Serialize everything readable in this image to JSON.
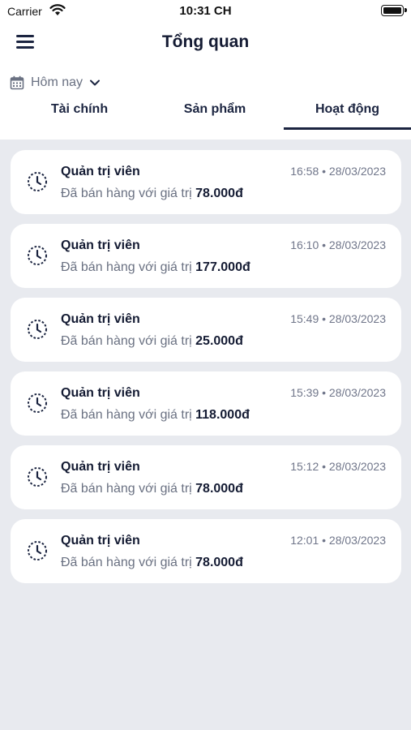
{
  "status_bar": {
    "carrier": "Carrier",
    "time": "10:31 CH"
  },
  "header": {
    "title": "Tổng quan",
    "menu_icon": "hamburger-menu-icon"
  },
  "filter": {
    "date_label": "Hôm nay",
    "calendar_icon": "calendar-icon",
    "dropdown_icon": "chevron-down-icon"
  },
  "tabs": [
    {
      "label": "Tài chính",
      "active": false
    },
    {
      "label": "Sản phẩm",
      "active": false
    },
    {
      "label": "Hoạt động",
      "active": true
    }
  ],
  "activities": [
    {
      "title": "Quản trị viên",
      "time": "16:58 • 28/03/2023",
      "desc": "Đã bán hàng với giá trị ",
      "amount": "78.000đ"
    },
    {
      "title": "Quản trị viên",
      "time": "16:10 • 28/03/2023",
      "desc": "Đã bán hàng với giá trị ",
      "amount": "177.000đ"
    },
    {
      "title": "Quản trị viên",
      "time": "15:49 • 28/03/2023",
      "desc": "Đã bán hàng với giá trị ",
      "amount": "25.000đ"
    },
    {
      "title": "Quản trị viên",
      "time": "15:39 • 28/03/2023",
      "desc": "Đã bán hàng với giá trị ",
      "amount": "118.000đ"
    },
    {
      "title": "Quản trị viên",
      "time": "15:12 • 28/03/2023",
      "desc": "Đã bán hàng với giá trị ",
      "amount": "78.000đ"
    },
    {
      "title": "Quản trị viên",
      "time": "12:01 • 28/03/2023",
      "desc": "Đã bán hàng với giá trị ",
      "amount": "78.000đ"
    }
  ],
  "colors": {
    "accent": "#1b2440",
    "background": "#e8eaef",
    "card": "#ffffff",
    "muted_text": "#6a7182"
  }
}
